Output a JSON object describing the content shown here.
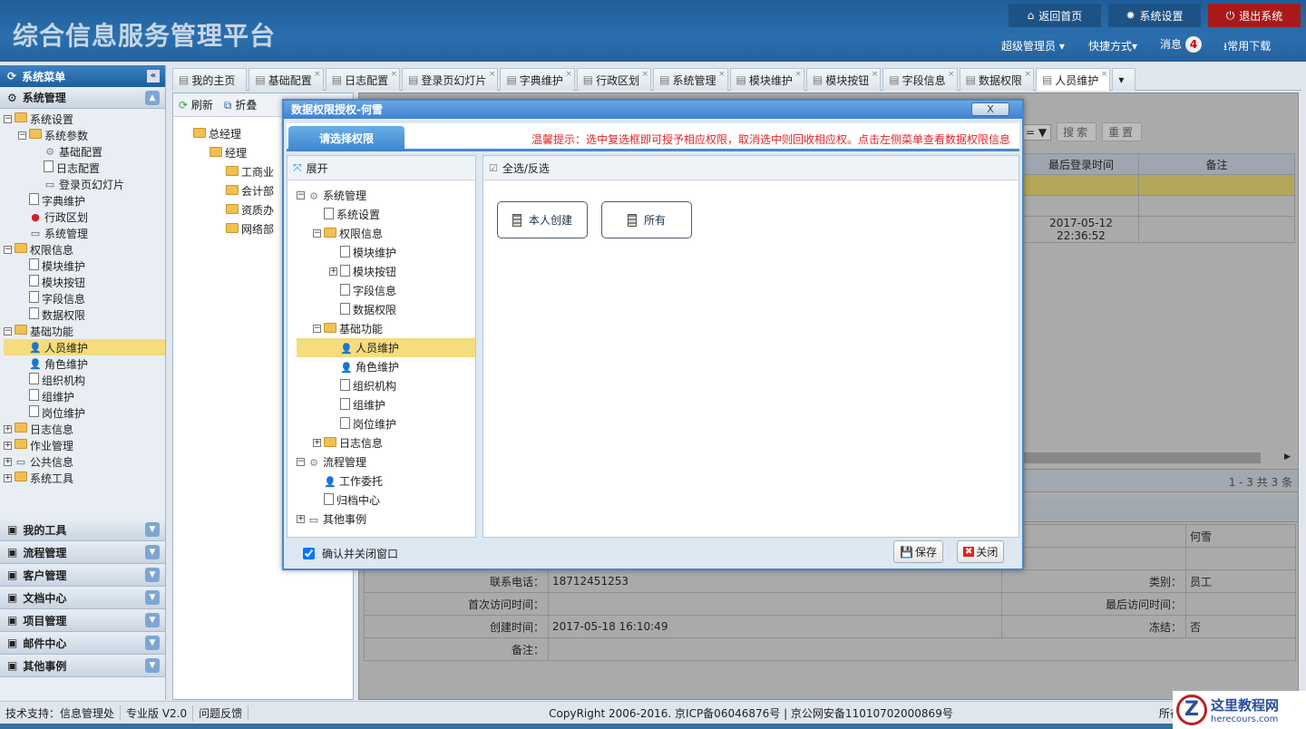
{
  "header": {
    "title": "综合信息服务管理平台",
    "buttons": [
      "返回首页",
      "系统设置",
      "退出系统"
    ],
    "user": "超级管理员 ▾",
    "shortcuts": "快捷方式▾",
    "messages": "消息",
    "message_count": "4",
    "downloads": "常用下载"
  },
  "sidebar": {
    "title": "系统菜单",
    "section": "系统管理",
    "tree": [
      {
        "l": 0,
        "t": "系统设置",
        "i": "folder",
        "pm": "−"
      },
      {
        "l": 1,
        "t": "系统参数",
        "i": "folder",
        "pm": "−"
      },
      {
        "l": 2,
        "t": "基础配置",
        "i": "gear"
      },
      {
        "l": 2,
        "t": "日志配置",
        "i": "doc"
      },
      {
        "l": 2,
        "t": "登录页幻灯片",
        "i": "img"
      },
      {
        "l": 1,
        "t": "字典维护",
        "i": "doc"
      },
      {
        "l": 1,
        "t": "行政区划",
        "i": "pin"
      },
      {
        "l": 1,
        "t": "系统管理",
        "i": "img"
      },
      {
        "l": 0,
        "t": "权限信息",
        "i": "folder",
        "pm": "−"
      },
      {
        "l": 1,
        "t": "模块维护",
        "i": "doc"
      },
      {
        "l": 1,
        "t": "模块按钮",
        "i": "doc"
      },
      {
        "l": 1,
        "t": "字段信息",
        "i": "doc"
      },
      {
        "l": 1,
        "t": "数据权限",
        "i": "doc"
      },
      {
        "l": 0,
        "t": "基础功能",
        "i": "folder",
        "pm": "−"
      },
      {
        "l": 1,
        "t": "人员维护",
        "i": "user",
        "sel": true
      },
      {
        "l": 1,
        "t": "角色维护",
        "i": "user"
      },
      {
        "l": 1,
        "t": "组织机构",
        "i": "doc"
      },
      {
        "l": 1,
        "t": "组维护",
        "i": "doc"
      },
      {
        "l": 1,
        "t": "岗位维护",
        "i": "doc"
      },
      {
        "l": 0,
        "t": "日志信息",
        "i": "folder",
        "pm": "+"
      },
      {
        "l": 0,
        "t": "作业管理",
        "i": "folder",
        "pm": "+"
      },
      {
        "l": 0,
        "t": "公共信息",
        "i": "img",
        "pm": "+"
      },
      {
        "l": 0,
        "t": "系统工具",
        "i": "folder",
        "pm": "+"
      }
    ],
    "accordions": [
      "我的工具",
      "流程管理",
      "客户管理",
      "文档中心",
      "项目管理",
      "邮件中心",
      "其他事例"
    ]
  },
  "tabs": [
    "我的主页",
    "基础配置",
    "日志配置",
    "登录页幻灯片",
    "字典维护",
    "行政区划",
    "系统管理",
    "模块维护",
    "模块按钮",
    "字段信息",
    "数据权限",
    "人员维护"
  ],
  "lefttree": {
    "refresh": "刷新",
    "collapse": "折叠",
    "items": [
      {
        "l": 0,
        "t": "总经理"
      },
      {
        "l": 1,
        "t": "经理"
      },
      {
        "l": 2,
        "t": "工商业"
      },
      {
        "l": 2,
        "t": "会计部"
      },
      {
        "l": 2,
        "t": "资质办"
      },
      {
        "l": 2,
        "t": "网络部"
      }
    ]
  },
  "main": {
    "op": "= ▼",
    "search": "搜索",
    "reset": "重置",
    "columns": [
      "最后登录时间",
      "备注"
    ],
    "rows": [
      [
        "",
        ""
      ],
      [
        "",
        ""
      ],
      [
        "2017-05-12 22:36:52",
        ""
      ]
    ],
    "pagination": "1 - 3   共 3 条",
    "form": [
      [
        "",
        "",
        "",
        "何雪"
      ],
      [
        "",
        "",
        "",
        ""
      ],
      [
        "联系电话：",
        "18712451253",
        "类别：",
        "员工"
      ],
      [
        "首次访问时间：",
        "",
        "最后访问时间：",
        ""
      ],
      [
        "创建时间：",
        "2017-05-18 16:10:49",
        "冻结：",
        "否"
      ],
      [
        "备注：",
        "",
        "",
        ""
      ]
    ]
  },
  "modal": {
    "title": "数据权限授权-何雪",
    "close": "X",
    "tab": "请选择权限",
    "hint": "温馨提示：选中复选框即可授予相应权限，取消选中则回收相应权。点击左侧菜单查看数据权限信息",
    "expand": "展开",
    "select_all": "全选/反选",
    "tree": [
      {
        "l": 0,
        "t": "系统管理",
        "pm": "−",
        "i": "gear"
      },
      {
        "l": 1,
        "t": "系统设置",
        "i": "doc"
      },
      {
        "l": 1,
        "t": "权限信息",
        "pm": "−",
        "i": "folder"
      },
      {
        "l": 2,
        "t": "模块维护",
        "i": "doc"
      },
      {
        "l": 2,
        "t": "模块按钮",
        "pm": "+",
        "i": "doc"
      },
      {
        "l": 2,
        "t": "字段信息",
        "i": "doc"
      },
      {
        "l": 2,
        "t": "数据权限",
        "i": "doc"
      },
      {
        "l": 1,
        "t": "基础功能",
        "pm": "−",
        "i": "folder"
      },
      {
        "l": 2,
        "t": "人员维护",
        "i": "user",
        "sel": true
      },
      {
        "l": 2,
        "t": "角色维护",
        "i": "user"
      },
      {
        "l": 2,
        "t": "组织机构",
        "i": "doc"
      },
      {
        "l": 2,
        "t": "组维护",
        "i": "doc"
      },
      {
        "l": 2,
        "t": "岗位维护",
        "i": "doc"
      },
      {
        "l": 1,
        "t": "日志信息",
        "pm": "+",
        "i": "folder"
      },
      {
        "l": 0,
        "t": "流程管理",
        "pm": "−",
        "i": "gear"
      },
      {
        "l": 1,
        "t": "工作委托",
        "i": "user"
      },
      {
        "l": 1,
        "t": "归档中心",
        "i": "doc"
      },
      {
        "l": 0,
        "t": "其他事例",
        "pm": "+",
        "i": "img"
      }
    ],
    "permissions": [
      "本人创建",
      "所有"
    ],
    "confirm_close": "确认并关闭窗口",
    "save": "保存",
    "close_btn": "关闭"
  },
  "footer": {
    "support": "技术支持：信息管理处",
    "version": "专业版 V2.0",
    "feedback": "问题反馈",
    "copyright": "CopyRight 2006-2016. 京ICP备06046876号 | 京公网安备11010702000869号",
    "dept": "所在部"
  },
  "watermark": {
    "name": "这里教程网",
    "url": "herecours.com"
  }
}
